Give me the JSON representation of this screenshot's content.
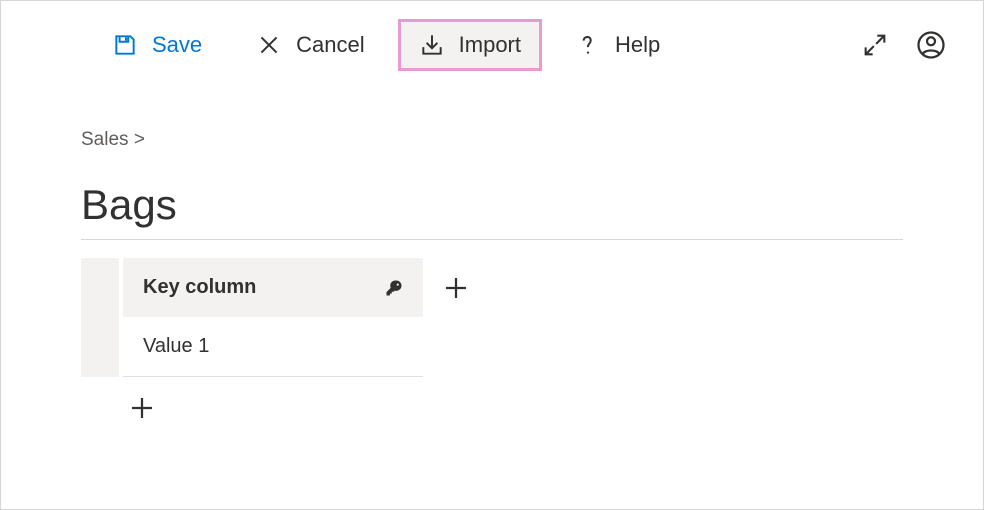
{
  "toolbar": {
    "save_label": "Save",
    "cancel_label": "Cancel",
    "import_label": "Import",
    "help_label": "Help"
  },
  "breadcrumb": {
    "parent": "Sales",
    "separator": ">"
  },
  "page": {
    "title": "Bags"
  },
  "table": {
    "key_column_label": "Key column",
    "rows": [
      {
        "value": "Value 1"
      }
    ]
  }
}
